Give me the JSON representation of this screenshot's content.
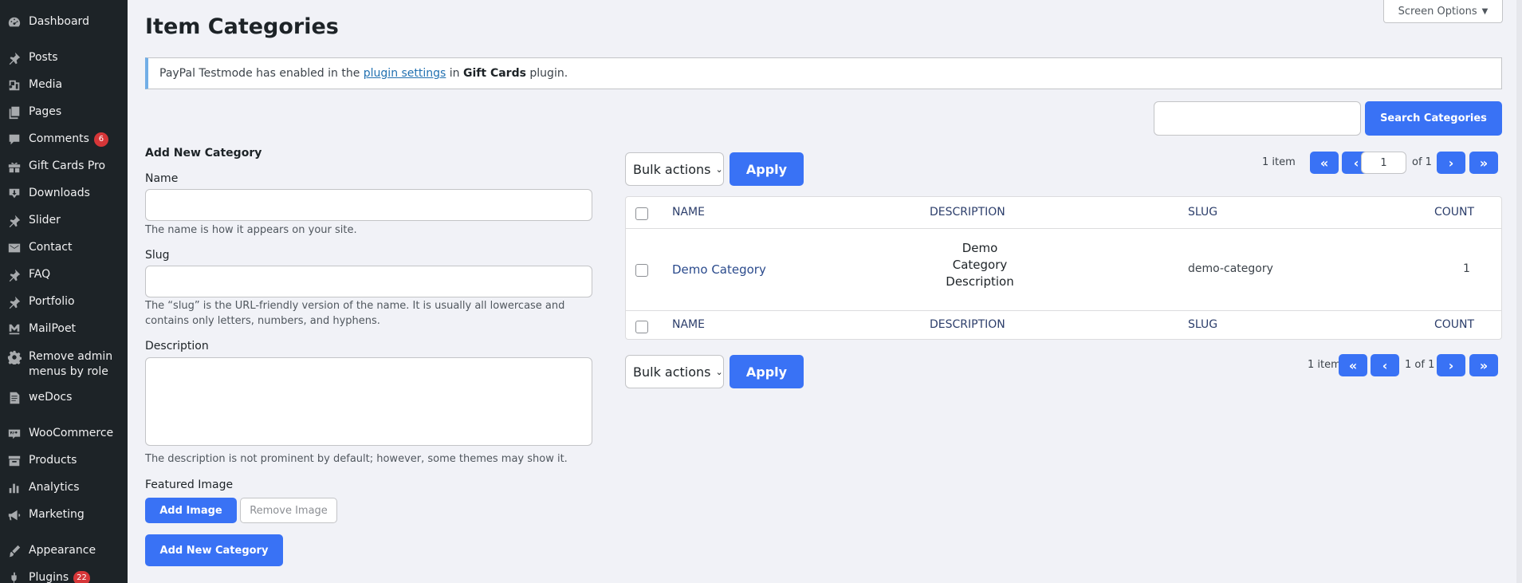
{
  "sidebar": {
    "items": [
      {
        "label": "Dashboard",
        "icon": "dashboard-icon"
      },
      {
        "label": "Posts",
        "icon": "pin-icon"
      },
      {
        "label": "Media",
        "icon": "media-icon"
      },
      {
        "label": "Pages",
        "icon": "pages-icon"
      },
      {
        "label": "Comments",
        "icon": "comment-icon",
        "badge": "6"
      },
      {
        "label": "Gift Cards Pro",
        "icon": "gift-icon"
      },
      {
        "label": "Downloads",
        "icon": "download-icon"
      },
      {
        "label": "Slider",
        "icon": "pin-icon"
      },
      {
        "label": "Contact",
        "icon": "mail-icon"
      },
      {
        "label": "FAQ",
        "icon": "pin-icon"
      },
      {
        "label": "Portfolio",
        "icon": "pin-icon"
      },
      {
        "label": "MailPoet",
        "icon": "mailpoet-icon"
      },
      {
        "label": "Remove admin menus by role",
        "icon": "gear-icon"
      },
      {
        "label": "weDocs",
        "icon": "doc-icon"
      },
      {
        "label": "WooCommerce",
        "icon": "woo-icon"
      },
      {
        "label": "Products",
        "icon": "archive-icon"
      },
      {
        "label": "Analytics",
        "icon": "bar-chart-icon"
      },
      {
        "label": "Marketing",
        "icon": "megaphone-icon"
      },
      {
        "label": "Appearance",
        "icon": "brush-icon"
      },
      {
        "label": "Plugins",
        "icon": "plugin-icon",
        "badge": "22"
      }
    ]
  },
  "header": {
    "title": "Item Categories",
    "screen_options": "Screen Options"
  },
  "notice": {
    "prefix": "PayPal Testmode has enabled in the",
    "link": "plugin settings",
    "middle": "in",
    "bold": "Gift Cards",
    "suffix": "plugin."
  },
  "search": {
    "button": "Search Categories",
    "value": ""
  },
  "form": {
    "title": "Add New Category",
    "name_label": "Name",
    "name_help": "The name is how it appears on your site.",
    "slug_label": "Slug",
    "slug_help": "The “slug” is the URL-friendly version of the name. It is usually all lowercase and contains only letters, numbers, and hyphens.",
    "description_label": "Description",
    "description_help": "The description is not prominent by default; however, some themes may show it.",
    "featured_image_label": "Featured Image",
    "add_image": "Add Image",
    "remove_image": "Remove Image",
    "submit": "Add New Category"
  },
  "table": {
    "bulk_actions": "Bulk actions",
    "apply": "Apply",
    "item_count": "1 item",
    "current_page": "1",
    "of_total": "of 1",
    "bottom_page": "1 of 1",
    "first": "«",
    "prev": "‹",
    "next": "›",
    "last": "»",
    "columns": {
      "name": "NAME",
      "description": "DESCRIPTION",
      "slug": "SLUG",
      "count": "COUNT"
    },
    "rows": [
      {
        "name": "Demo Category",
        "description": "Demo Category Description",
        "slug": "demo-category",
        "count": "1"
      }
    ]
  },
  "colors": {
    "accent": "#3972f5",
    "sidebar_bg": "#1d2327",
    "badge": "#d63638"
  }
}
